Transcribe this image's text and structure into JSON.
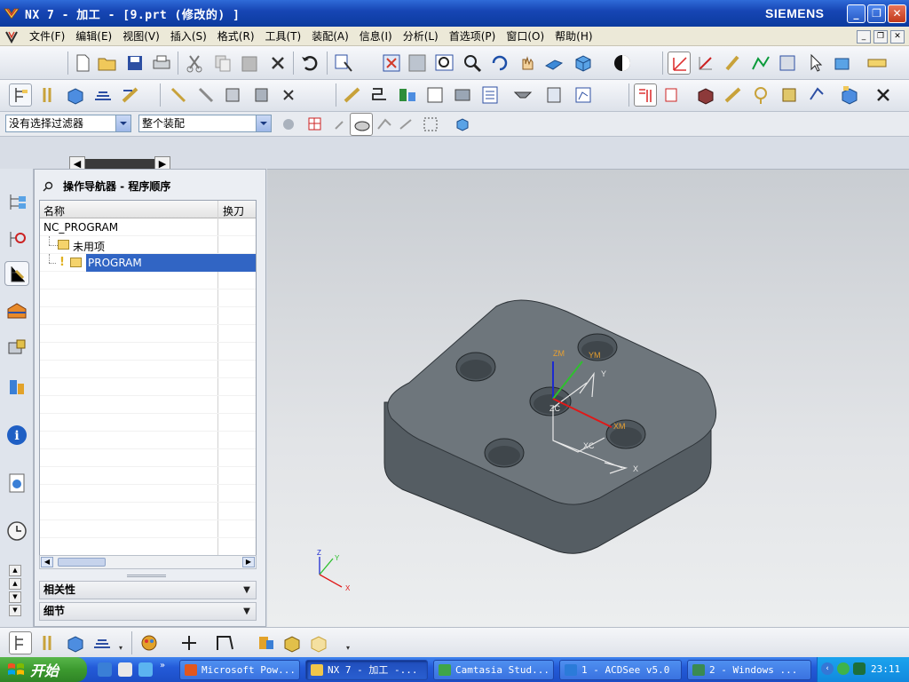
{
  "window": {
    "title": "NX 7 - 加工 - [9.prt (修改的) ]",
    "brand": "SIEMENS",
    "controls": {
      "minimize": "_",
      "restore": "❐",
      "close": "✕"
    }
  },
  "menu": {
    "items": [
      "文件(F)",
      "编辑(E)",
      "视图(V)",
      "插入(S)",
      "格式(R)",
      "工具(T)",
      "装配(A)",
      "信息(I)",
      "分析(L)",
      "首选项(P)",
      "窗口(O)",
      "帮助(H)"
    ]
  },
  "toolbar": {
    "start_label": "开始",
    "selection_filter": "没有选择过滤器",
    "scope": "整个装配"
  },
  "navigator": {
    "title": "操作导航器 - 程序顺序",
    "columns": [
      "名称",
      "换刀"
    ],
    "rows": [
      {
        "name": "NC_PROGRAM"
      },
      {
        "name": "未用项"
      },
      {
        "name": "PROGRAM",
        "selected": true
      }
    ],
    "sections": [
      "相关性",
      "细节"
    ]
  },
  "graphics": {
    "csys_labels": {
      "zm": "ZM",
      "ym": "YM",
      "xm": "XM",
      "zc": "ZC",
      "yc": "Y",
      "xc": "XC",
      "x": "X"
    },
    "triad_labels": {
      "z": "Z",
      "y": "Y",
      "x": "X"
    }
  },
  "taskbar": {
    "start": "开始",
    "items": [
      {
        "label": "Microsoft Pow...",
        "color": "#e2571e"
      },
      {
        "label": "NX 7 - 加工 -...",
        "color": "#c9d4f2",
        "active": true
      },
      {
        "label": "Camtasia Stud...",
        "color": "#3fa548"
      },
      {
        "label": "1 - ACDSee v5.0",
        "color": "#2b7bd9"
      },
      {
        "label": "2 - Windows ...",
        "color": "#3a8a52"
      }
    ],
    "clock": "23:11"
  }
}
